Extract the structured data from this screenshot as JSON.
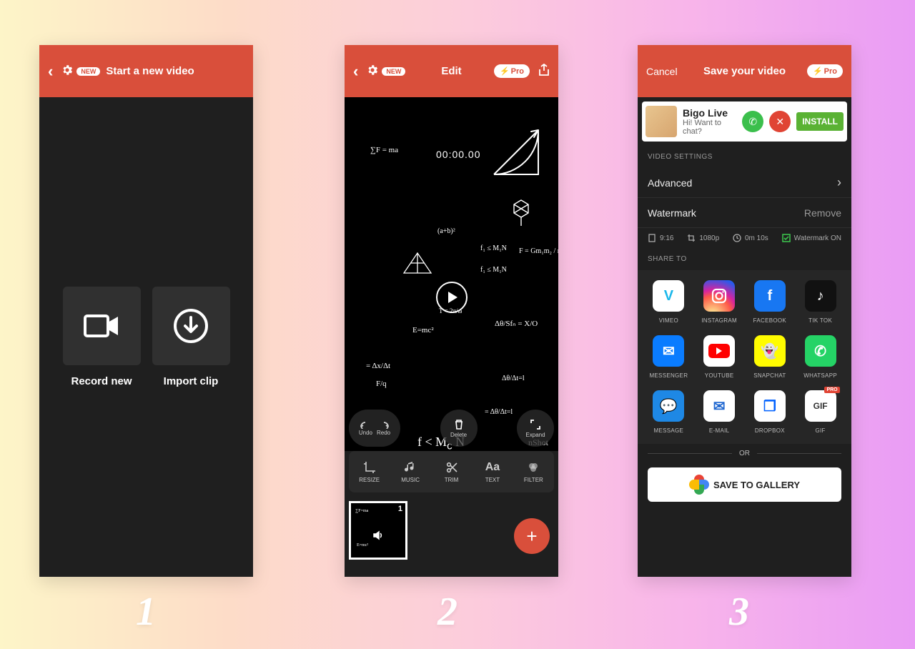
{
  "accent": "#d94f3b",
  "numbers": [
    "1",
    "2",
    "3"
  ],
  "screen1": {
    "new_badge": "NEW",
    "title": "Start a new video",
    "record": "Record new",
    "import": "Import clip"
  },
  "screen2": {
    "new_badge": "NEW",
    "title": "Edit",
    "pro": "Pro",
    "timecode": "00:00.00",
    "controls": {
      "undo": "Undo",
      "redo": "Redo",
      "delete": "Delete",
      "expand": "Expand"
    },
    "tools": [
      {
        "id": "resize",
        "label": "RESIZE"
      },
      {
        "id": "music",
        "label": "MUSIC"
      },
      {
        "id": "trim",
        "label": "TRIM"
      },
      {
        "id": "text",
        "label": "TEXT",
        "icon_text": "Aa"
      },
      {
        "id": "filter",
        "label": "FILTER"
      }
    ],
    "clip_number": "1",
    "watermark_text": "nShot"
  },
  "screen3": {
    "cancel": "Cancel",
    "title": "Save your video",
    "pro": "Pro",
    "ad": {
      "title": "Bigo Live",
      "subtitle": "Hi! Want to chat?",
      "button": "INSTALL"
    },
    "settings_label": "VIDEO SETTINGS",
    "rows": {
      "advanced": "Advanced",
      "watermark": "Watermark",
      "watermark_action": "Remove"
    },
    "stats": {
      "ratio": "9:16",
      "res": "1080p",
      "dur": "0m 10s",
      "wm": "Watermark ON"
    },
    "share_label": "SHARE TO",
    "share": [
      {
        "id": "vimeo",
        "label": "VIMEO",
        "bg": "#ffffff",
        "fg": "#1ab7ea",
        "glyph": "V"
      },
      {
        "id": "instagram",
        "label": "INSTAGRAM"
      },
      {
        "id": "facebook",
        "label": "FACEBOOK",
        "bg": "#1877f2",
        "glyph": "f"
      },
      {
        "id": "tiktok",
        "label": "TIK TOK",
        "bg": "#111",
        "glyph": "♪"
      },
      {
        "id": "messenger",
        "label": "MESSENGER",
        "bg": "#0a7cff",
        "glyph": "✉"
      },
      {
        "id": "youtube",
        "label": "YOUTUBE",
        "bg": "#ffffff"
      },
      {
        "id": "snapchat",
        "label": "SNAPCHAT",
        "bg": "#fffc00",
        "glyph": "👻"
      },
      {
        "id": "whatsapp",
        "label": "WHATSAPP",
        "bg": "#25d366",
        "glyph": "✆"
      },
      {
        "id": "message",
        "label": "MESSAGE",
        "bg": "#1e88e5",
        "glyph": "💬"
      },
      {
        "id": "email",
        "label": "E-MAIL",
        "bg": "#ffffff",
        "fg": "#1e66d0",
        "glyph": "✉"
      },
      {
        "id": "dropbox",
        "label": "DROPBOX",
        "bg": "#ffffff",
        "fg": "#0061ff",
        "glyph": "❒"
      },
      {
        "id": "gif",
        "label": "GIF",
        "bg": "#ffffff",
        "fg": "#333",
        "glyph": "GIF",
        "pro": "PRO"
      }
    ],
    "or": "OR",
    "save_gallery": "SAVE TO GALLERY"
  }
}
